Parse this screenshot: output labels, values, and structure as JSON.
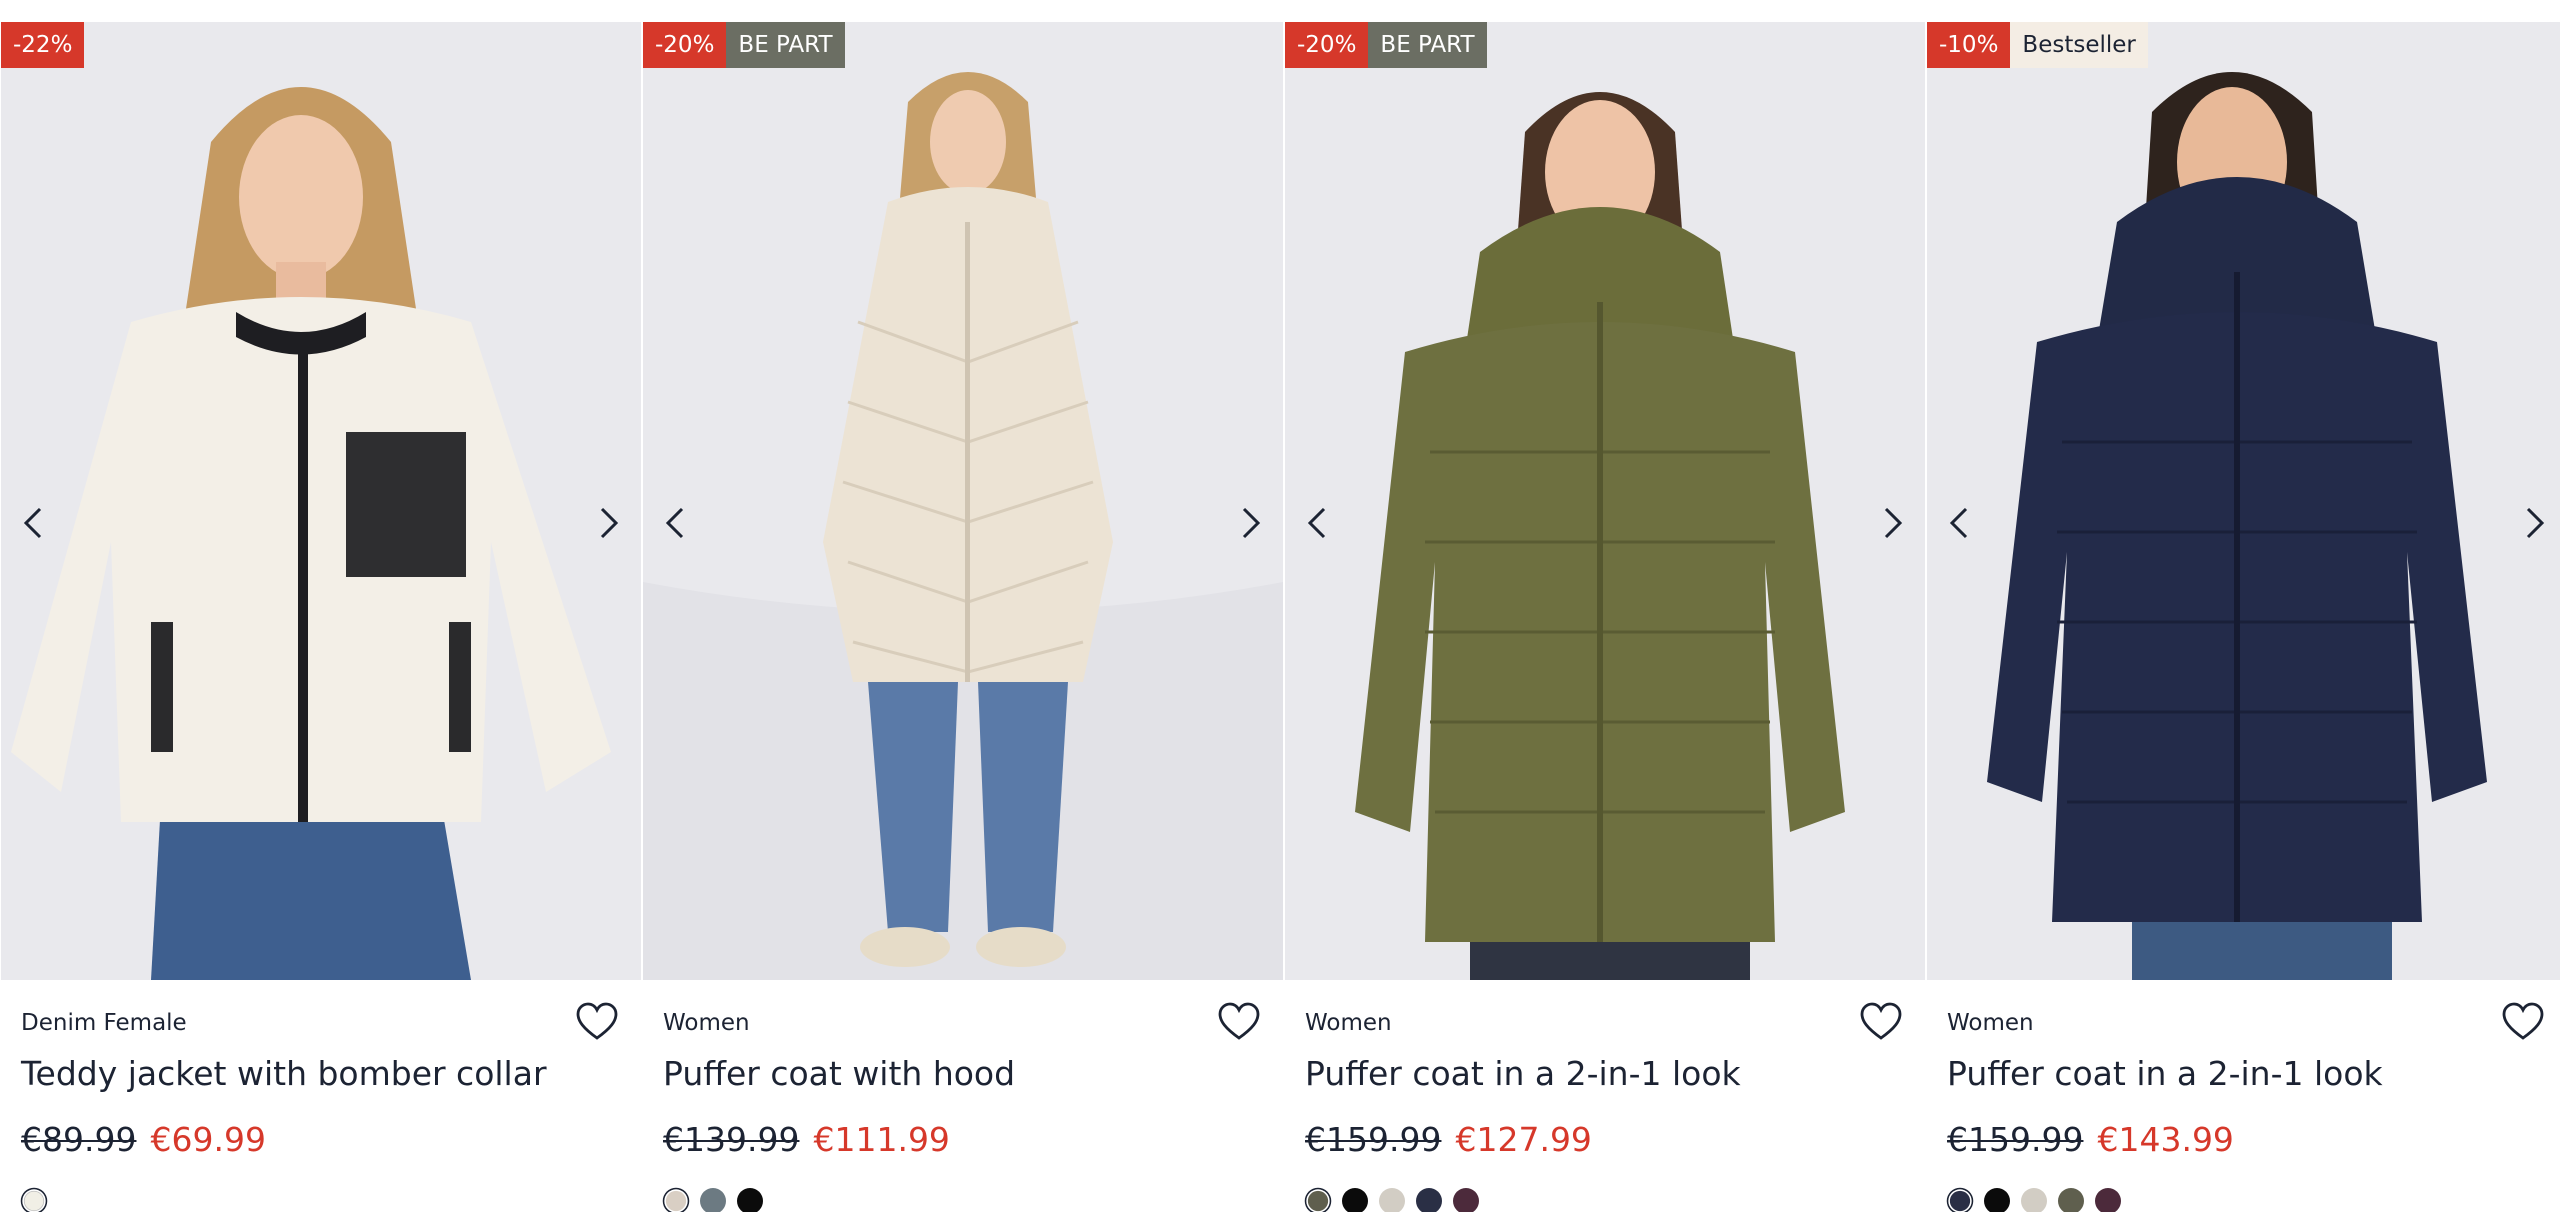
{
  "products": [
    {
      "badges": [
        {
          "text": "-22%",
          "kind": "discount"
        }
      ],
      "brand": "Denim Female",
      "title": "Teddy jacket with bomber collar",
      "old_price": "€89.99",
      "new_price": "€69.99",
      "image_subject": "woman in cream teddy bomber jacket with black pocket",
      "swatches": [
        "#f1efe6"
      ],
      "active_swatch": 0
    },
    {
      "badges": [
        {
          "text": "-20%",
          "kind": "discount"
        },
        {
          "text": "BE PART",
          "kind": "bepart"
        }
      ],
      "brand": "Women",
      "title": "Puffer coat with hood",
      "old_price": "€139.99",
      "new_price": "€111.99",
      "image_subject": "woman in long cream puffer coat and blue jeans",
      "swatches": [
        "#d9cfc4",
        "#6c7a82",
        "#0b0b0b"
      ],
      "active_swatch": 0
    },
    {
      "badges": [
        {
          "text": "-20%",
          "kind": "discount"
        },
        {
          "text": "BE PART",
          "kind": "bepart"
        }
      ],
      "brand": "Women",
      "title": "Puffer coat in a 2-in-1 look",
      "old_price": "€159.99",
      "new_price": "€127.99",
      "image_subject": "woman in olive green hooded puffer coat",
      "swatches": [
        "#5f5f4e",
        "#0b0b0b",
        "#d2cdc4",
        "#2a2f45",
        "#4c2a3b"
      ],
      "active_swatch": 0
    },
    {
      "badges": [
        {
          "text": "-10%",
          "kind": "discount"
        },
        {
          "text": "Bestseller",
          "kind": "best"
        }
      ],
      "brand": "Women",
      "title": "Puffer coat in a 2-in-1 look",
      "old_price": "€159.99",
      "new_price": "€143.99",
      "image_subject": "woman in navy hooded puffer coat",
      "swatches": [
        "#2a2f45",
        "#0b0b0b",
        "#d2cdc4",
        "#5f5f4e",
        "#4c2a3b"
      ],
      "active_swatch": 0
    }
  ],
  "colors": {
    "discount": "#d6382a",
    "bepart": "#6b6e63",
    "bestseller_bg": "#f4ede4",
    "text": "#1c2333",
    "image_bg": "#e9e9ed"
  },
  "icons": {
    "prev": "chevron-left-icon",
    "next": "chevron-right-icon",
    "favorite": "heart-icon"
  }
}
